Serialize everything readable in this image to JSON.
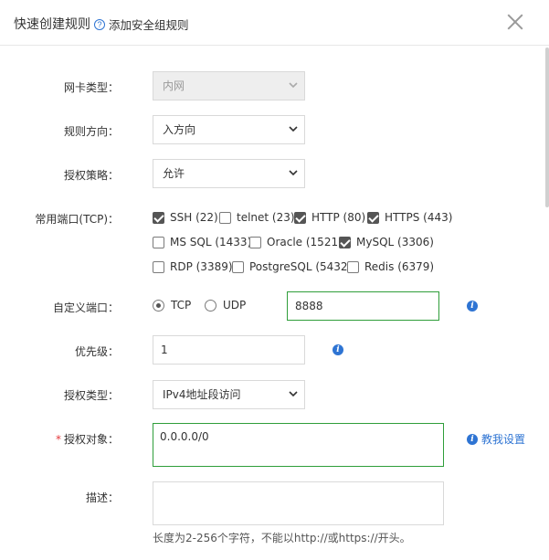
{
  "header": {
    "title": "快速创建规则",
    "help_icon": "?",
    "help_link": "添加安全组规则"
  },
  "form": {
    "nic_type": {
      "label": "网卡类型：",
      "value": "内网"
    },
    "direction": {
      "label": "规则方向：",
      "value": "入方向"
    },
    "policy": {
      "label": "授权策略：",
      "value": "允许"
    },
    "common_ports": {
      "label": "常用端口(TCP)：",
      "options": [
        {
          "label": "SSH (22)",
          "checked": true
        },
        {
          "label": "telnet (23)",
          "checked": false
        },
        {
          "label": "HTTP (80)",
          "checked": true
        },
        {
          "label": "HTTPS (443)",
          "checked": true
        },
        {
          "label": "MS SQL (1433)",
          "checked": false
        },
        {
          "label": "Oracle (1521)",
          "checked": false
        },
        {
          "label": "MySQL (3306)",
          "checked": true
        },
        {
          "label": "RDP (3389)",
          "checked": false
        },
        {
          "label": "PostgreSQL (5432)",
          "checked": false
        },
        {
          "label": "Redis (6379)",
          "checked": false
        }
      ]
    },
    "custom_port": {
      "label": "自定义端口：",
      "tcp_label": "TCP",
      "udp_label": "UDP",
      "selected": "TCP",
      "value": "8888"
    },
    "priority": {
      "label": "优先级：",
      "value": "1"
    },
    "auth_type": {
      "label": "授权类型：",
      "value": "IPv4地址段访问"
    },
    "auth_object": {
      "label": "授权对象：",
      "required_mark": "*",
      "value": "0.0.0.0/0",
      "teach_link": "教我设置"
    },
    "description": {
      "label": "描述：",
      "value": "",
      "hint": "长度为2-256个字符，不能以http://或https://开头。"
    }
  },
  "icons": {
    "info": "info-icon",
    "close": "close-icon",
    "chevron": "chevron-down-icon",
    "help": "help-circle-icon"
  },
  "colors": {
    "accent_blue": "#2e74d3",
    "focus_green": "#2f9e3a",
    "required_red": "#e4393c",
    "disabled_bg": "#eeeeee"
  }
}
